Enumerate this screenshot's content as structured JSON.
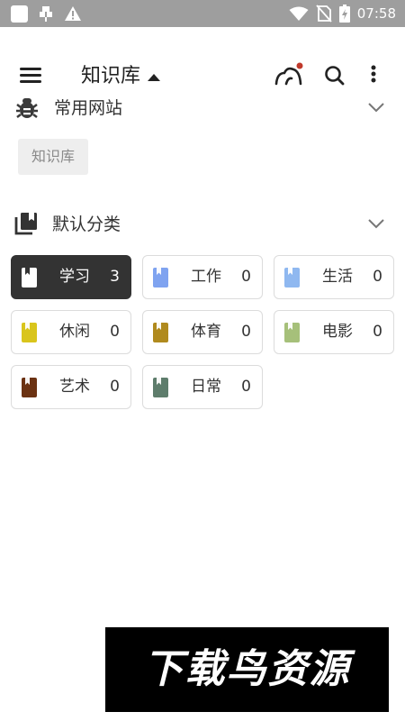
{
  "status_bar": {
    "time": "07:58",
    "left_icons": [
      "notification-square-icon",
      "bug-status-icon",
      "warning-icon"
    ],
    "right_icons": [
      "wifi-icon",
      "no-sim-icon",
      "battery-charging-icon"
    ]
  },
  "app_bar": {
    "title": "知识库",
    "icons": [
      "menu-icon",
      "dropdown-caret-icon",
      "sync-cloud-icon",
      "search-icon",
      "more-vert-icon"
    ],
    "notification_dot_color": "#c0392b"
  },
  "sections": {
    "common_sites": {
      "title": "常用网站",
      "icon": "bug-icon",
      "chips": [
        "知识库"
      ]
    },
    "default_categories": {
      "title": "默认分类",
      "icon": "stacked-books-icon",
      "items": [
        {
          "label": "学习",
          "count": "3",
          "color": "#ffffff",
          "active": true
        },
        {
          "label": "工作",
          "count": "0",
          "color": "#7fa3f0"
        },
        {
          "label": "生活",
          "count": "0",
          "color": "#8fb8f0"
        },
        {
          "label": "休闲",
          "count": "0",
          "color": "#d9c51c"
        },
        {
          "label": "体育",
          "count": "0",
          "color": "#b08a1e"
        },
        {
          "label": "电影",
          "count": "0",
          "color": "#a6c07a"
        },
        {
          "label": "艺术",
          "count": "0",
          "color": "#6b3212"
        },
        {
          "label": "日常",
          "count": "0",
          "color": "#5e7d6c"
        }
      ]
    }
  },
  "watermark": {
    "text": "下载鸟资源"
  }
}
